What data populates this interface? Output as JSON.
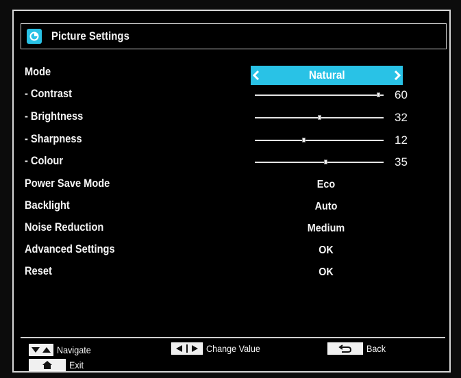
{
  "header": {
    "title": "Picture Settings",
    "icon": "picture-settings-icon"
  },
  "mode": {
    "label": "Mode",
    "value": "Natural"
  },
  "sliders": [
    {
      "label": "- Contrast",
      "value": "60",
      "level": 0.96
    },
    {
      "label": "- Brightness",
      "value": "32",
      "level": 0.5
    },
    {
      "label": "- Sharpness",
      "value": "12",
      "level": 0.38
    },
    {
      "label": "- Colour",
      "value": "35",
      "level": 0.55
    }
  ],
  "options": [
    {
      "label": "Power Save Mode",
      "value": "Eco"
    },
    {
      "label": "Backlight",
      "value": "Auto"
    },
    {
      "label": "Noise Reduction",
      "value": "Medium"
    },
    {
      "label": "Advanced Settings",
      "value": "OK"
    },
    {
      "label": "Reset",
      "value": "OK"
    }
  ],
  "footer": {
    "navigate": "Navigate",
    "change_value": "Change Value",
    "back": "Back",
    "exit": "Exit"
  },
  "colors": {
    "accent": "#29c2e6",
    "background": "#000000",
    "text": "#f5f5f5"
  }
}
